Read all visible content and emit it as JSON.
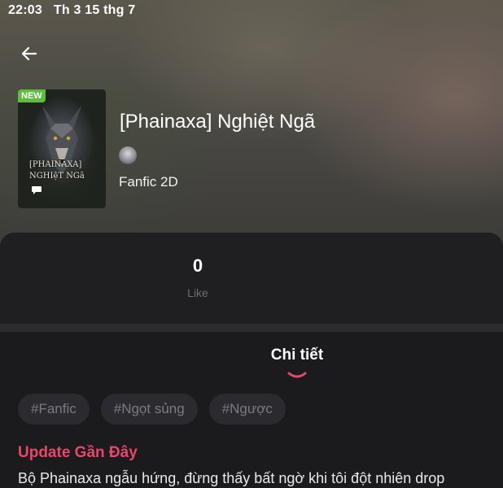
{
  "status_bar": {
    "time": "22:03",
    "date": "Th 3 15 thg 7"
  },
  "book": {
    "badge": "NEW",
    "cover_title_line1": "[PHAINAXA]",
    "cover_title_line2": "NGHIệT NGã",
    "title": "[Phainaxa] Nghiệt Ngã",
    "genre": "Fanfic 2D"
  },
  "stats": {
    "likes_value": "0",
    "likes_label": "Like"
  },
  "tabs": {
    "active": "Chi tiết"
  },
  "tags": [
    "#Fanfic",
    "#Ngọt sủng",
    "#Ngược"
  ],
  "update": {
    "heading": "Update Gần Đây",
    "text": "Bộ Phainaxa ngẫu hứng, đừng thấy bất ngờ khi tôi đột nhiên drop"
  },
  "colors": {
    "accent": "#e8466b",
    "badge": "#5ebc3e"
  },
  "icons": {
    "back": "arrow-left-icon",
    "cover_chat": "chat-bubble-icon",
    "tab_indicator": "smile-underline-icon"
  }
}
